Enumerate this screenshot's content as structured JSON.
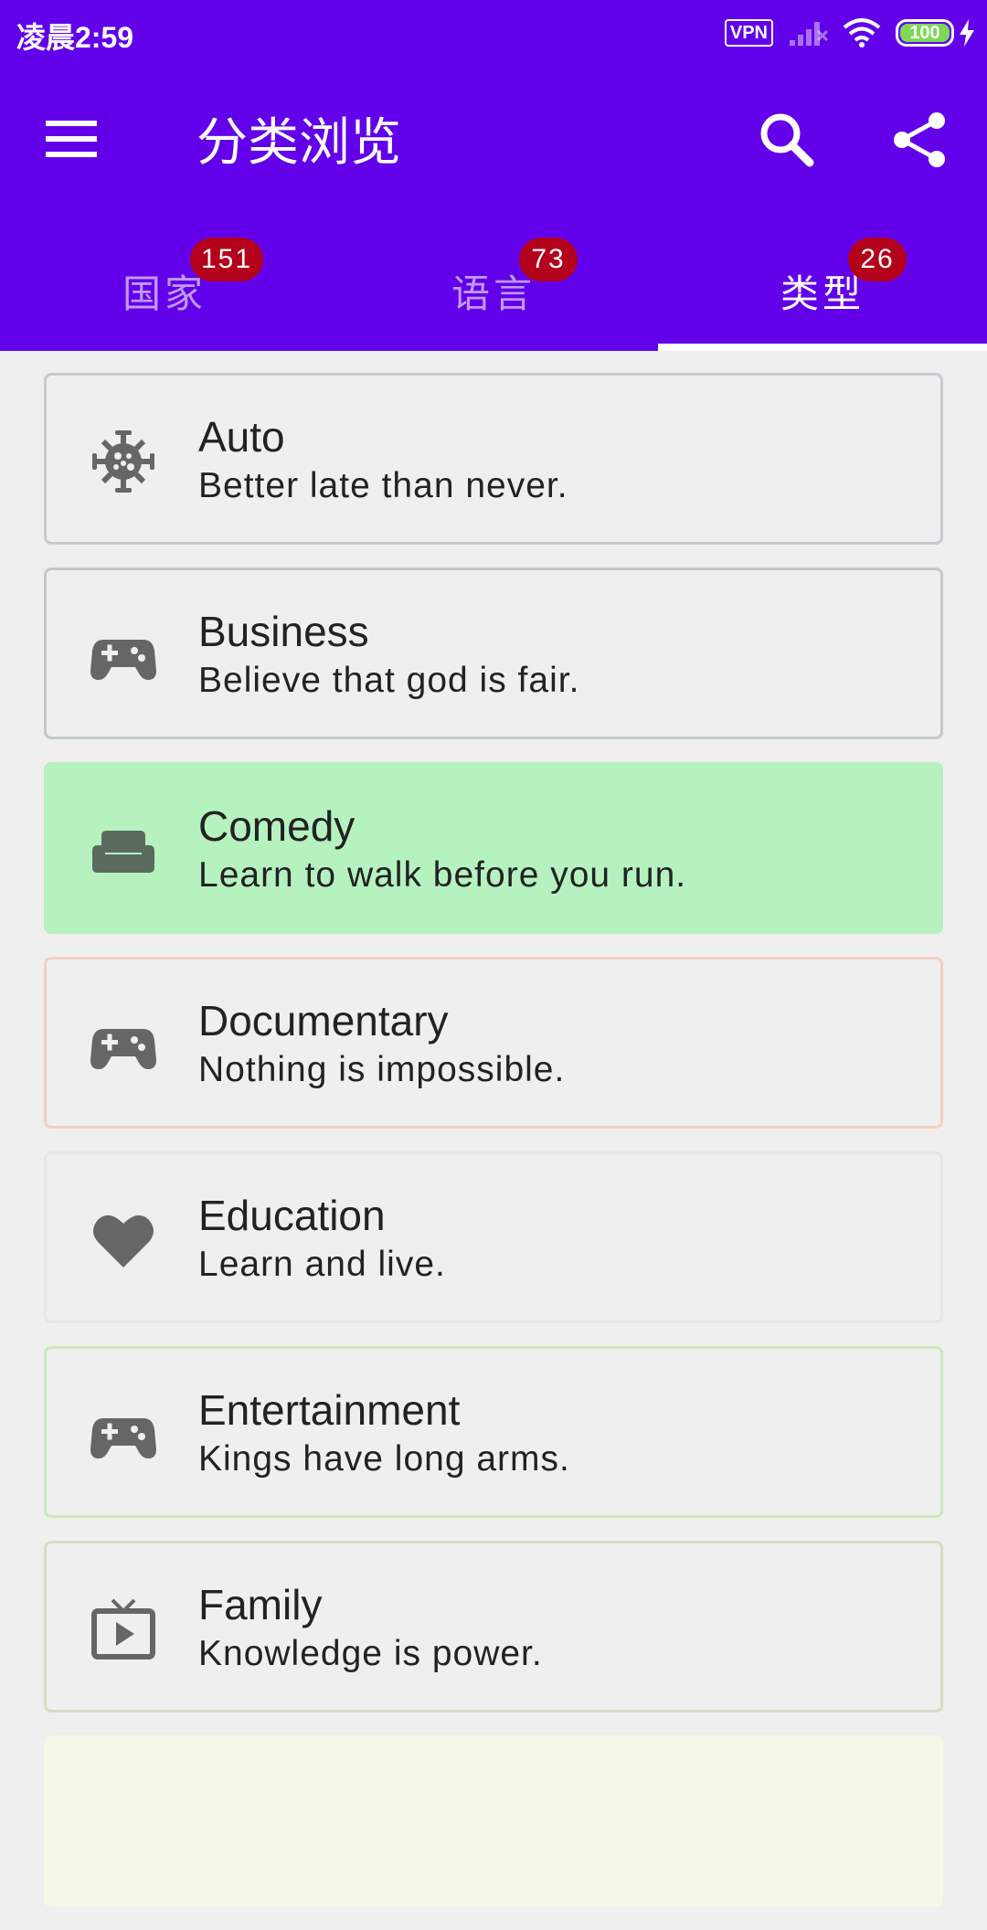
{
  "status_bar": {
    "time": "凌晨2:59",
    "vpn": "VPN",
    "battery": "100"
  },
  "app_bar": {
    "title": "分类浏览"
  },
  "tabs": [
    {
      "label": "国家",
      "badge": "151",
      "active": false
    },
    {
      "label": "语言",
      "badge": "73",
      "active": false
    },
    {
      "label": "类型",
      "badge": "26",
      "active": true
    }
  ],
  "categories": [
    {
      "title": "Auto",
      "subtitle": "Better late than never.",
      "icon": "virus-icon",
      "border": "#c8c8d0",
      "background": "#efefef"
    },
    {
      "title": "Business",
      "subtitle": "Believe that god is fair.",
      "icon": "gamepad-icon",
      "border": "#c3c9c9",
      "background": "#efefef"
    },
    {
      "title": "Comedy",
      "subtitle": "Learn to walk before you run.",
      "icon": "couch-icon",
      "border": "#b5f2c0",
      "background": "#b5f2c0"
    },
    {
      "title": "Documentary",
      "subtitle": "Nothing is impossible.",
      "icon": "gamepad-icon",
      "border": "#f5cfc2",
      "background": "#efefef"
    },
    {
      "title": "Education",
      "subtitle": "Learn and live.",
      "icon": "heart-icon",
      "border": "#e6e6ea",
      "background": "#efefef"
    },
    {
      "title": "Entertainment",
      "subtitle": "Kings have long arms.",
      "icon": "gamepad-icon",
      "border": "#cce9c0",
      "background": "#efefef"
    },
    {
      "title": "Family",
      "subtitle": "Knowledge is power.",
      "icon": "tv-icon",
      "border": "#d6dcc6",
      "background": "#efefef"
    }
  ]
}
